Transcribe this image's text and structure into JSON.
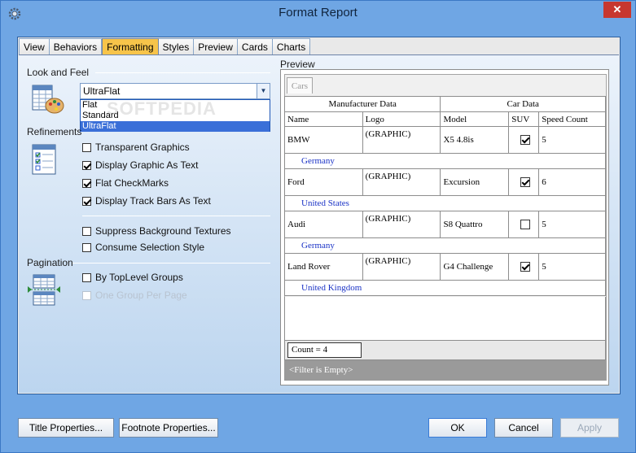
{
  "window": {
    "title": "Format Report",
    "close_label": "✕"
  },
  "tabs": [
    {
      "label": "View"
    },
    {
      "label": "Behaviors"
    },
    {
      "label": "Formatting",
      "active": true
    },
    {
      "label": "Styles"
    },
    {
      "label": "Preview"
    },
    {
      "label": "Cards"
    },
    {
      "label": "Charts"
    }
  ],
  "look_and_feel": {
    "label": "Look and Feel",
    "combo_value": "UltraFlat",
    "options": [
      "Flat",
      "Standard",
      "UltraFlat"
    ],
    "selected": "UltraFlat"
  },
  "refinements": {
    "label": "Refinements",
    "items": [
      {
        "label": "Transparent Graphics",
        "checked": false
      },
      {
        "label": "Display Graphic As Text",
        "checked": true
      },
      {
        "label": "Flat CheckMarks",
        "checked": true
      },
      {
        "label": "Display Track Bars As Text",
        "checked": true
      },
      {
        "label": "Suppress Background Textures",
        "checked": false
      },
      {
        "label": "Consume Selection Style",
        "checked": false
      }
    ]
  },
  "pagination": {
    "label": "Pagination",
    "items": [
      {
        "label": "By TopLevel Groups",
        "checked": false,
        "disabled": false
      },
      {
        "label": "One Group Per Page",
        "checked": false,
        "disabled": true
      }
    ]
  },
  "preview": {
    "label": "Preview",
    "tab": "Cars",
    "group_headers": [
      "Manufacturer Data",
      "Car Data"
    ],
    "columns": [
      "Name",
      "Logo",
      "Model",
      "SUV",
      "Speed Count"
    ],
    "rows": [
      {
        "name": "BMW",
        "logo": "(GRAPHIC)",
        "model": "X5 4.8is",
        "suv": true,
        "speed": "5",
        "country": "Germany"
      },
      {
        "name": "Ford",
        "logo": "(GRAPHIC)",
        "model": "Excursion",
        "suv": true,
        "speed": "6",
        "country": "United States"
      },
      {
        "name": "Audi",
        "logo": "(GRAPHIC)",
        "model": "S8 Quattro",
        "suv": false,
        "speed": "5",
        "country": "Germany"
      },
      {
        "name": "Land Rover",
        "logo": "(GRAPHIC)",
        "model": "G4 Challenge",
        "suv": true,
        "speed": "5",
        "country": "United Kingdom"
      }
    ],
    "count_text": "Count = 4",
    "filter_text": "<Filter is Empty>"
  },
  "buttons": {
    "title_properties": "Title Properties...",
    "footnote_properties": "Footnote Properties...",
    "ok": "OK",
    "cancel": "Cancel",
    "apply": "Apply"
  },
  "watermark": "SOFTPEDIA",
  "colors": {
    "accent": "#6fa6e4",
    "active_tab": "#f7c44a",
    "selection": "#3a6fd8",
    "country_text": "#1b33c6"
  }
}
